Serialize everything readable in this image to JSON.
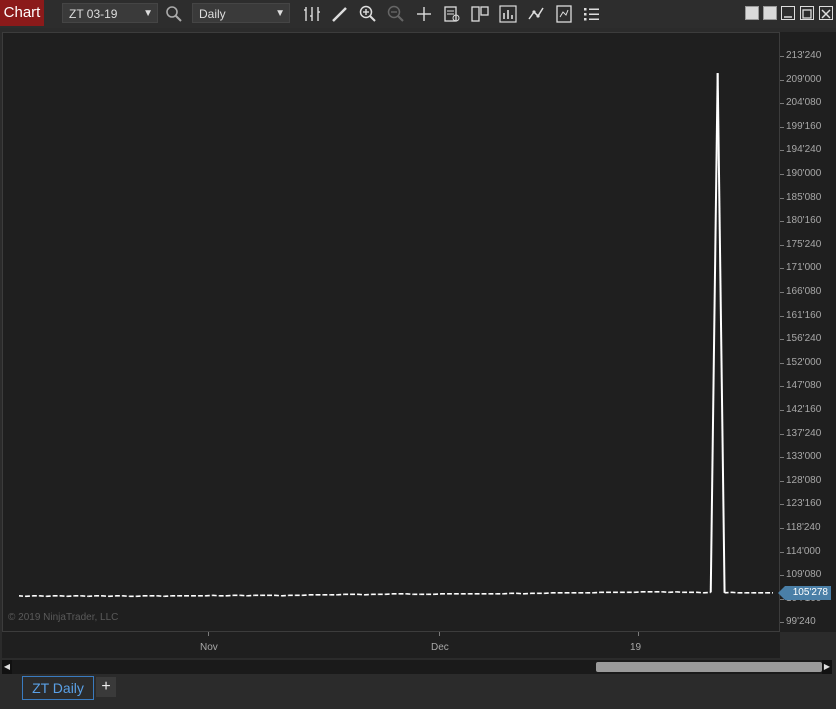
{
  "toolbar": {
    "chart_label": "Chart",
    "instrument": "ZT 03-19",
    "interval": "Daily",
    "icons": [
      "search-icon",
      "bars-type-icon",
      "drawing-tool-icon",
      "zoom-in-icon",
      "zoom-out-icon",
      "crosshair-icon",
      "data-box-icon",
      "templates-icon",
      "indicators-icon",
      "strategies-icon",
      "properties-icon",
      "chart-trader-icon"
    ]
  },
  "window_buttons": [
    "tile-icon",
    "tile-icon",
    "minimize-icon",
    "maximize-icon",
    "close-icon"
  ],
  "chart": {
    "copyright": "© 2019 NinjaTrader, LLC",
    "last_price_label": "105'278",
    "y_ticks": [
      "213'240",
      "209'000",
      "204'080",
      "199'160",
      "194'240",
      "190'000",
      "185'080",
      "180'160",
      "175'240",
      "171'000",
      "166'080",
      "161'160",
      "156'240",
      "152'000",
      "147'080",
      "142'160",
      "137'240",
      "133'000",
      "128'080",
      "123'160",
      "118'240",
      "114'000",
      "109'080",
      "104'160",
      "99'240"
    ],
    "x_ticks": [
      "Nov",
      "Dec",
      "19"
    ]
  },
  "chart_data": {
    "type": "line",
    "y_ticks": [
      "213'240",
      "209'000",
      "204'080",
      "199'160",
      "194'240",
      "190'000",
      "185'080",
      "180'160",
      "175'240",
      "171'000",
      "166'080",
      "161'160",
      "156'240",
      "152'000",
      "147'080",
      "142'160",
      "137'240",
      "133'000",
      "128'080",
      "123'160",
      "118'240",
      "114'000",
      "109'080",
      "104'160",
      "99'240"
    ],
    "x_labels": [
      "Nov",
      "Dec",
      "19"
    ],
    "last_price": "105'278",
    "series": [
      {
        "values": [
          105.3,
          105.2,
          105.3,
          105.3,
          105.2,
          105.3,
          105.3,
          105.2,
          105.3,
          105.3,
          105.2,
          105.3,
          105.3,
          105.2,
          105.3,
          105.3,
          105.2,
          105.2,
          105.3,
          105.3,
          105.3,
          105.2,
          105.3,
          105.3,
          105.3,
          105.3,
          105.3,
          105.3,
          105.4,
          105.3,
          105.3,
          105.4,
          105.4,
          105.3,
          105.4,
          105.4,
          105.4,
          105.4,
          105.3,
          105.4,
          105.4,
          105.4,
          105.5,
          105.5,
          105.5,
          105.5,
          105.5,
          105.6,
          105.6,
          105.6,
          105.5,
          105.6,
          105.6,
          105.6,
          105.7,
          105.7,
          105.7,
          105.6,
          105.6,
          105.6,
          105.6,
          105.7,
          105.7,
          105.7,
          105.7,
          105.7,
          105.7,
          105.7,
          105.7,
          105.7,
          105.7,
          105.8,
          105.8,
          105.7,
          105.8,
          105.8,
          105.8,
          105.9,
          105.9,
          105.9,
          105.9,
          105.9,
          105.9,
          105.9,
          106.0,
          106.0,
          106.0,
          106.0,
          106.0,
          106.0,
          106.1,
          106.1,
          106.1,
          106.1,
          106.0,
          106.1,
          106.0,
          106.0,
          106.0,
          105.9,
          106.0,
          210.5,
          105.9,
          106.0,
          105.9,
          105.9,
          105.9,
          105.9,
          105.9,
          105.9
        ]
      }
    ]
  }
}
